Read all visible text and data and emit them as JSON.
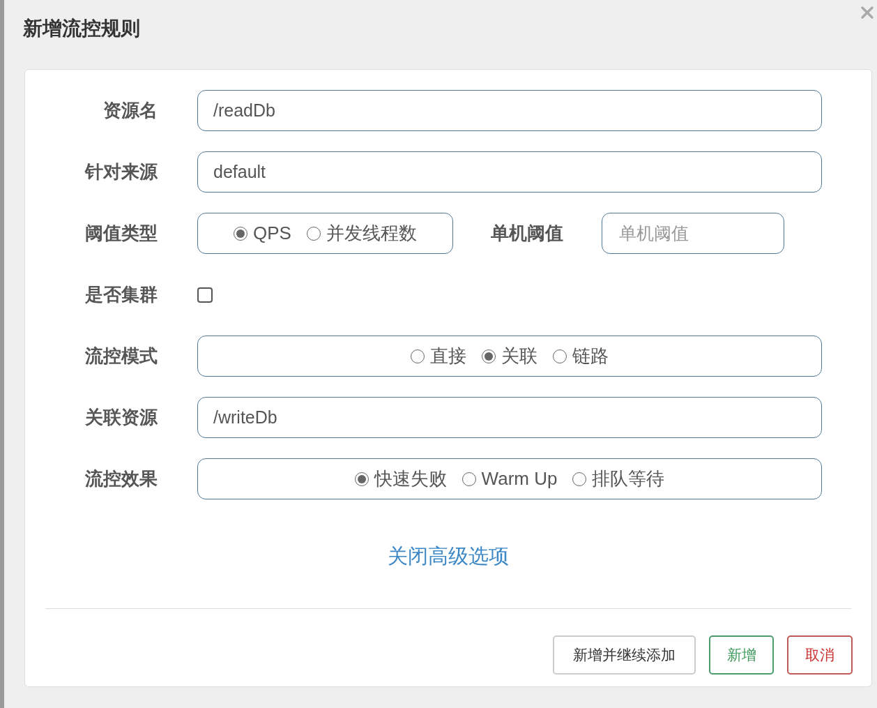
{
  "dialog": {
    "title": "新增流控规则"
  },
  "fields": [
    {
      "kind": "input",
      "label": "资源名",
      "value": "/readDb"
    },
    {
      "kind": "input",
      "label": "针对来源",
      "value": "default"
    },
    {
      "kind": "radio",
      "label": "阈值类型",
      "options": [
        {
          "label": "QPS",
          "selected": true
        },
        {
          "label": "并发线程数",
          "selected": false
        }
      ],
      "side": {
        "label": "单机阈值",
        "placeholder": "单机阈值"
      }
    },
    {
      "kind": "checkbox",
      "label": "是否集群",
      "checked": false
    },
    {
      "kind": "radio",
      "label": "流控模式",
      "options": [
        {
          "label": "直接",
          "selected": false
        },
        {
          "label": "关联",
          "selected": true
        },
        {
          "label": "链路",
          "selected": false
        }
      ]
    },
    {
      "kind": "input",
      "label": "关联资源",
      "value": "/writeDb"
    },
    {
      "kind": "radio",
      "label": "流控效果",
      "options": [
        {
          "label": "快速失败",
          "selected": true
        },
        {
          "label": "Warm Up",
          "selected": false
        },
        {
          "label": "排队等待",
          "selected": false
        }
      ]
    }
  ],
  "advanced_link": "关闭高级选项",
  "buttons": [
    {
      "label": "新增并继续添加",
      "kind": "default"
    },
    {
      "label": "新增",
      "kind": "success"
    },
    {
      "label": "取消",
      "kind": "danger"
    }
  ]
}
